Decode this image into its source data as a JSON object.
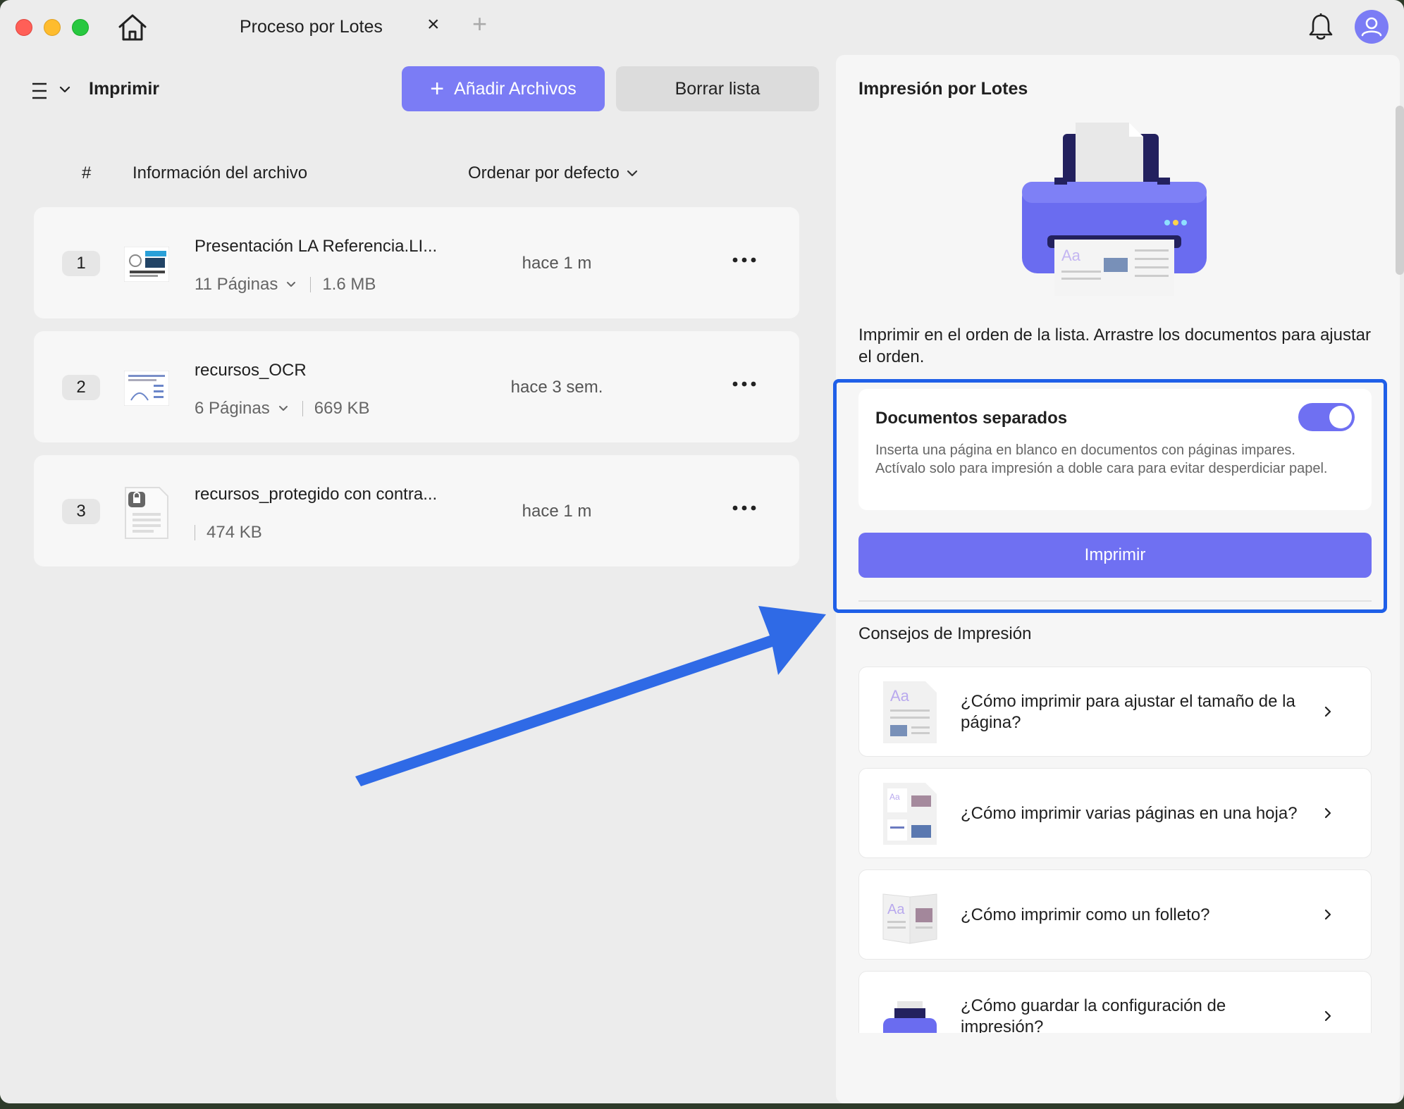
{
  "titlebar": {
    "tab_title": "Proceso por Lotes",
    "close_glyph": "×",
    "new_tab_glyph": "+"
  },
  "toolbar": {
    "mode_label": "Imprimir",
    "add_files_label": "Añadir Archivos",
    "clear_list_label": "Borrar lista"
  },
  "list_header": {
    "hash": "#",
    "info": "Información del archivo",
    "sort": "Ordenar por defecto"
  },
  "files": [
    {
      "num": "1",
      "name": "Presentación LA Referencia.LI...",
      "pages": "11 Páginas",
      "size": "1.6 MB",
      "time": "hace 1 m"
    },
    {
      "num": "2",
      "name": "recursos_OCR",
      "pages": "6 Páginas",
      "size": "669 KB",
      "time": "hace 3 sem."
    },
    {
      "num": "3",
      "name": "recursos_protegido con contra...",
      "pages": "",
      "size": "474 KB",
      "time": "hace 1 m"
    }
  ],
  "right_panel": {
    "title": "Impresión por Lotes",
    "illustration_text": "Aa",
    "description": "Imprimir en el orden de la lista. Arrastre los documentos para ajustar el orden.",
    "option": {
      "title": "Documentos separados",
      "description": "Inserta una página en blanco en documentos con páginas impares. Actívalo solo para impresión a doble cara para evitar desperdiciar papel.",
      "enabled": true
    },
    "print_label": "Imprimir",
    "tips_title": "Consejos de Impresión",
    "tips": [
      {
        "text": "¿Cómo imprimir para ajustar el tamaño de la página?",
        "thumb_text": "Aa"
      },
      {
        "text": "¿Cómo imprimir varias páginas en una hoja?",
        "thumb_text": "Aa"
      },
      {
        "text": "¿Cómo imprimir como un folleto?",
        "thumb_text": "Aa"
      },
      {
        "text": "¿Cómo guardar la configuración de impresión?",
        "thumb_text": ""
      }
    ]
  },
  "icons": {
    "home": "home-icon",
    "bell": "bell-icon",
    "avatar": "user-icon",
    "menu": "menu-icon",
    "more": "more-icon",
    "chevron": "chevron-down-icon"
  },
  "colors": {
    "accent": "#7b7cf5",
    "highlight": "#1f5fe8",
    "toggle_on": "#6f70f2"
  }
}
